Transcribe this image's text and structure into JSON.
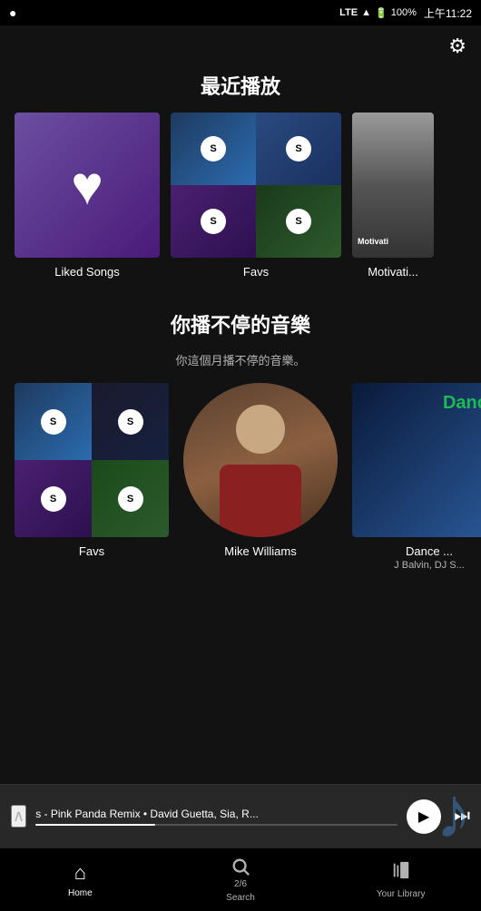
{
  "statusBar": {
    "carrier": "",
    "signal": "LTE",
    "battery": "100%",
    "time": "上午11:22"
  },
  "header": {
    "settingsLabel": "⚙"
  },
  "recentlyPlayed": {
    "title": "最近播放",
    "items": [
      {
        "id": "liked-songs",
        "label": "Liked Songs",
        "type": "liked"
      },
      {
        "id": "favs",
        "label": "Favs",
        "type": "favs-collage"
      },
      {
        "id": "motivation",
        "label": "Motivati...",
        "type": "motivation"
      }
    ]
  },
  "youSection": {
    "title": "你播不停的音樂",
    "subtitle": "你這個月播不停的音樂。",
    "items": [
      {
        "id": "favs2",
        "label": "Favs",
        "sublabel": "",
        "type": "favs-you"
      },
      {
        "id": "mike-williams",
        "label": "Mike Williams",
        "sublabel": "",
        "type": "artist"
      },
      {
        "id": "dance",
        "label": "Dance ...",
        "sublabel": "J Balvin, DJ S...",
        "type": "dance"
      }
    ]
  },
  "nowPlaying": {
    "chevron": "∧",
    "trackText": "s - Pink Panda Remix • David Guetta, Sia, R...",
    "progressPercent": 33
  },
  "bottomNav": {
    "items": [
      {
        "id": "home",
        "icon": "⌂",
        "label": "Home",
        "active": true
      },
      {
        "id": "search",
        "icon": "⌕",
        "label": "Search",
        "active": false
      },
      {
        "id": "library",
        "icon": "▤",
        "label": "Your Library",
        "active": false
      }
    ]
  },
  "pageIndicator": "2/6"
}
